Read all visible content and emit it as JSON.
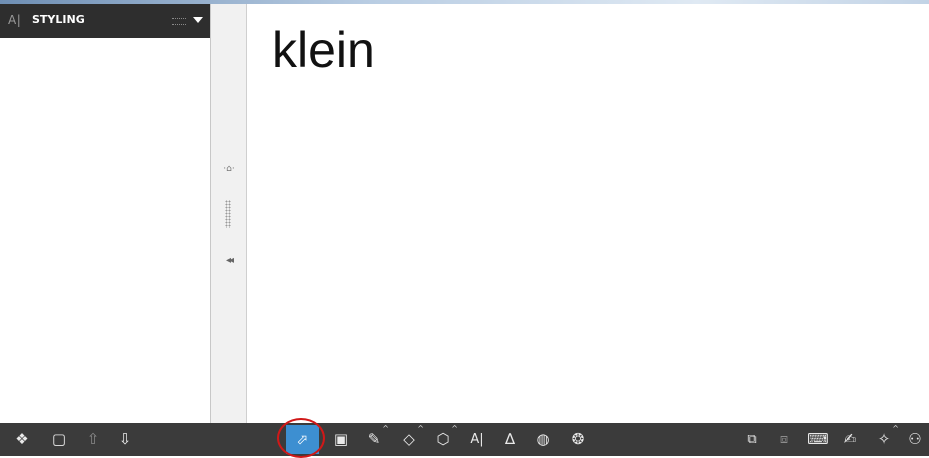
{
  "styling_panel": {
    "logo": "A|",
    "title": "STYLING"
  },
  "splitter": {
    "pin_glyph": "·⌂·",
    "collapse_glyph": "◂◂"
  },
  "canvas": {
    "text": "klein"
  },
  "toolbar": {
    "left_tools": [
      {
        "name": "layers-icon",
        "glyph": "❖"
      },
      {
        "name": "screen-icon",
        "glyph": "▢"
      },
      {
        "name": "arrow-up-icon",
        "glyph": "⇧"
      },
      {
        "name": "arrow-down-icon",
        "glyph": "⇩"
      }
    ],
    "center_tools": [
      {
        "name": "select-arrow-icon",
        "glyph": "⬀"
      },
      {
        "name": "comment-icon",
        "glyph": "▣"
      },
      {
        "name": "pen-icon",
        "glyph": "✎"
      },
      {
        "name": "eraser-icon",
        "glyph": "◇"
      },
      {
        "name": "shape-hexagon-icon",
        "glyph": "⬡"
      },
      {
        "name": "text-tool-icon",
        "glyph": "A|"
      },
      {
        "name": "math-tool-icon",
        "glyph": "∆"
      },
      {
        "name": "globe-icon",
        "glyph": "◍"
      },
      {
        "name": "gallery-icon",
        "glyph": "❂"
      }
    ],
    "right_tools": [
      {
        "name": "screen-capture-icon",
        "glyph": "⧉"
      },
      {
        "name": "camera-icon",
        "glyph": "⧈"
      },
      {
        "name": "keyboard-icon",
        "glyph": "⌨"
      },
      {
        "name": "handwriting-icon",
        "glyph": "✍"
      },
      {
        "name": "magic-wand-icon",
        "glyph": "✧"
      },
      {
        "name": "binoculars-icon",
        "glyph": "⚇"
      }
    ]
  }
}
